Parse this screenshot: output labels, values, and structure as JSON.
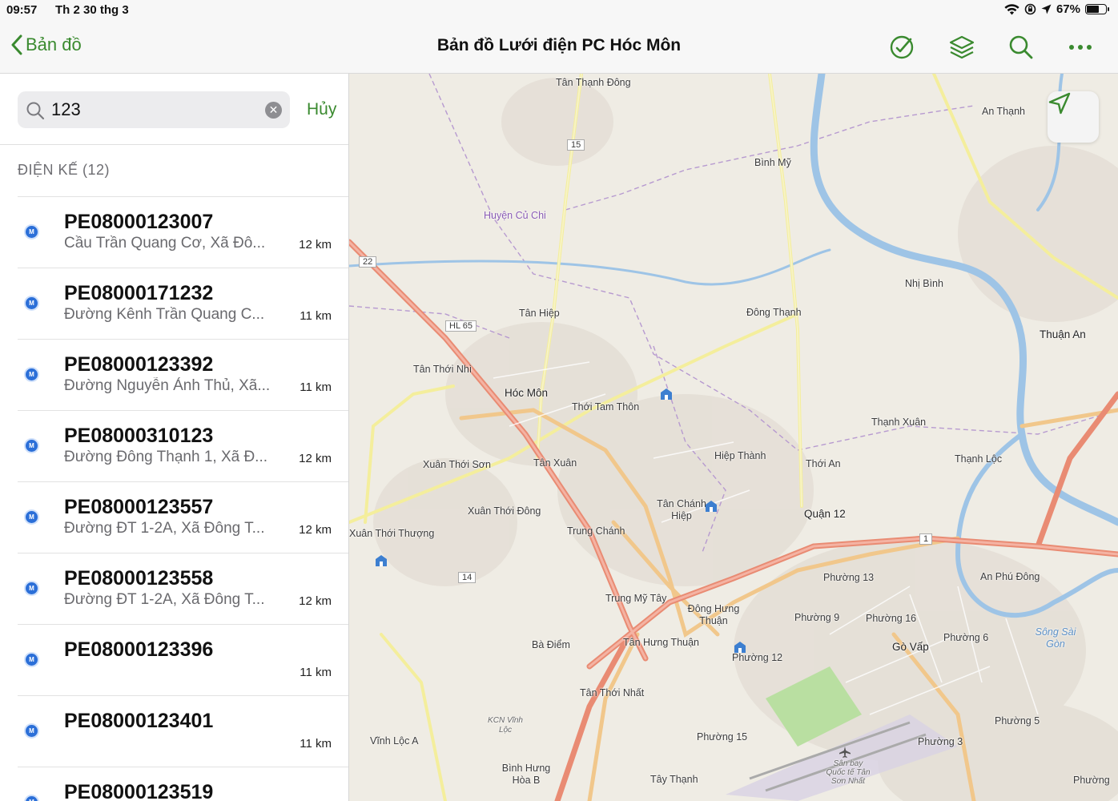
{
  "status_bar": {
    "time": "09:57",
    "date": "Th 2 30 thg 3",
    "battery": "67%",
    "battery_level": 0.67
  },
  "nav": {
    "back_label": "Bản đồ",
    "title": "Bản đồ Lưới điện PC Hóc Môn",
    "icons": [
      "edit-check-icon",
      "layers-icon",
      "search-icon",
      "more-icon"
    ]
  },
  "search": {
    "value": "123",
    "placeholder": "",
    "cancel_label": "Hủy"
  },
  "section": {
    "header": "ĐIỆN KẾ (12)"
  },
  "results": [
    {
      "code": "PE08000123007",
      "address": "Cầu Trần Quang Cơ, Xã Đô...",
      "distance": "12 km"
    },
    {
      "code": "PE08000171232",
      "address": "Đường Kênh Trần Quang C...",
      "distance": "11 km"
    },
    {
      "code": "PE08000123392",
      "address": "Đường Nguyễn Ảnh Thủ, Xã...",
      "distance": "11 km"
    },
    {
      "code": "PE08000310123",
      "address": "Đường Đông Thạnh 1, Xã Đ...",
      "distance": "12 km"
    },
    {
      "code": "PE08000123557",
      "address": "Đường ĐT 1-2A, Xã Đông T...",
      "distance": "12 km"
    },
    {
      "code": "PE08000123558",
      "address": "Đường ĐT 1-2A, Xã Đông T...",
      "distance": "12 km"
    },
    {
      "code": "PE08000123396",
      "address": "",
      "distance": "11 km"
    },
    {
      "code": "PE08000123401",
      "address": "",
      "distance": "11 km"
    },
    {
      "code": "PE08000123519",
      "address": "",
      "distance": ""
    }
  ],
  "map": {
    "labels": [
      "Tân Thạnh Đông",
      "An Thạnh",
      "Bình Mỹ",
      "Huyện Củ Chi",
      "Nhị Bình",
      "Tân Hiệp",
      "Đông Thạnh",
      "Thuận An",
      "Tân Thới Nhì",
      "Hóc Môn",
      "Thới Tam Thôn",
      "Thạnh Xuân",
      "Hiệp Thành",
      "Thới An",
      "Thạnh Lộc",
      "Xuân Thới Sơn",
      "Tân Xuân",
      "Tân Chánh Hiệp",
      "Quận 12",
      "Xuân Thới Đông",
      "Trung Chánh",
      "Xuân Thới Thượng",
      "Phường 13",
      "An Phú Đông",
      "Trung Mỹ Tây",
      "Đông Hưng Thuận",
      "Phường 9",
      "Phường 16",
      "Phường 6",
      "Bà Điểm",
      "Tân Hưng Thuận",
      "Phường 12",
      "Gò Vấp",
      "Sông Sài Gòn",
      "Tân Thới Nhất",
      "Phường 15",
      "Phường 3",
      "Phường 5",
      "Vĩnh Lộc A",
      "Bình Hưng Hòa B",
      "Tây Thạnh",
      "Phường",
      "KCN Vĩnh Lộc",
      "Sân bay Quốc tế Tân Sơn Nhất",
      "15",
      "22",
      "HL 65",
      "14",
      "1"
    ],
    "colors": {
      "background": "#efece4",
      "highway": "#e98b73",
      "primary_road": "#f1c78b",
      "secondary_road": "#f4ee9c",
      "river": "#9ec4e6",
      "boundary": "#b79ad0",
      "park": "#b9dfa1"
    }
  },
  "accent_color": "#3a8a2f"
}
